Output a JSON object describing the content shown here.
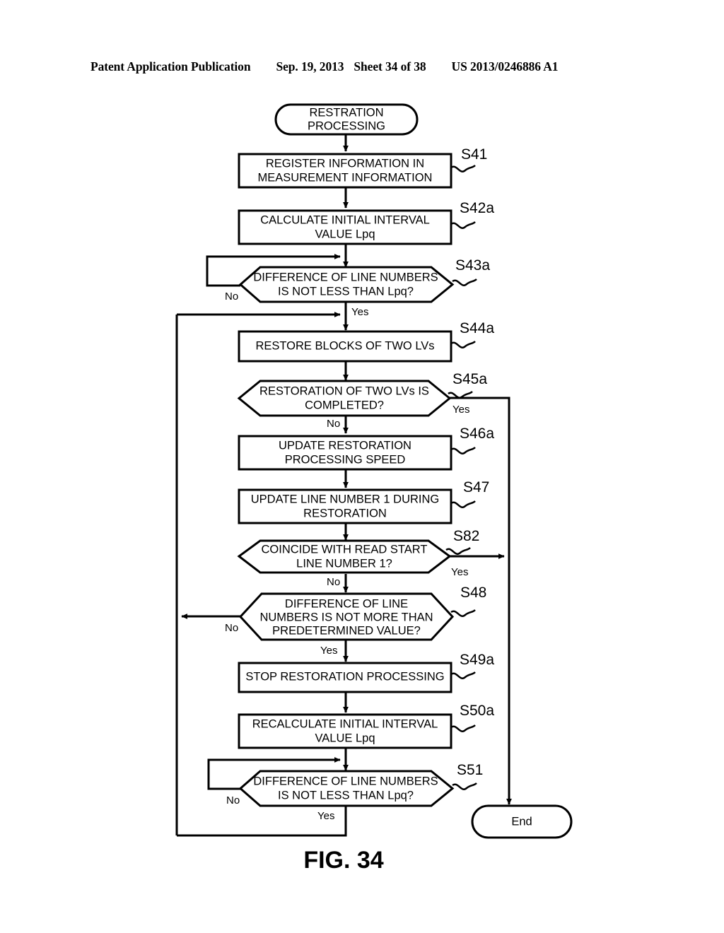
{
  "header": {
    "publication": "Patent Application Publication",
    "date": "Sep. 19, 2013",
    "sheet": "Sheet 34 of 38",
    "patent_number": "US 2013/0246886 A1"
  },
  "figure": {
    "caption": "FIG. 34"
  },
  "flowchart": {
    "start": {
      "line1": "RESTRATION",
      "line2": "PROCESSING"
    },
    "end": {
      "label": "End"
    },
    "nodes": [
      {
        "id": "S41",
        "type": "process",
        "step": "S41",
        "line1": "REGISTER INFORMATION IN",
        "line2": "MEASUREMENT INFORMATION"
      },
      {
        "id": "S42a",
        "type": "process",
        "step": "S42a",
        "line1": "CALCULATE INITIAL INTERVAL",
        "line2": "VALUE Lpq"
      },
      {
        "id": "S43a",
        "type": "decision",
        "step": "S43a",
        "line1": "DIFFERENCE OF LINE NUMBERS",
        "line2": "IS NOT LESS THAN Lpq?",
        "no_label": "No",
        "yes_label": "Yes"
      },
      {
        "id": "S44a",
        "type": "process",
        "step": "S44a",
        "line1": "RESTORE BLOCKS OF TWO LVs",
        "line2": ""
      },
      {
        "id": "S45a",
        "type": "decision",
        "step": "S45a",
        "line1": "RESTORATION OF TWO LVs IS",
        "line2": "COMPLETED?",
        "no_label": "No",
        "yes_label": "Yes"
      },
      {
        "id": "S46a",
        "type": "process",
        "step": "S46a",
        "line1": "UPDATE RESTORATION",
        "line2": "PROCESSING SPEED"
      },
      {
        "id": "S47",
        "type": "process",
        "step": "S47",
        "line1": "UPDATE LINE NUMBER 1 DURING",
        "line2": "RESTORATION"
      },
      {
        "id": "S82",
        "type": "decision",
        "step": "S82",
        "line1": "COINCIDE WITH READ START",
        "line2": "LINE NUMBER 1?",
        "no_label": "No",
        "yes_label": "Yes"
      },
      {
        "id": "S48",
        "type": "decision3",
        "step": "S48",
        "line1": "DIFFERENCE OF LINE",
        "line2": "NUMBERS IS NOT MORE THAN",
        "line3": "PREDETERMINED VALUE?",
        "no_label": "No",
        "yes_label": "Yes"
      },
      {
        "id": "S49a",
        "type": "process",
        "step": "S49a",
        "line1": "STOP RESTORATION PROCESSING",
        "line2": ""
      },
      {
        "id": "S50a",
        "type": "process",
        "step": "S50a",
        "line1": "RECALCULATE INITIAL INTERVAL",
        "line2": "VALUE Lpq"
      },
      {
        "id": "S51",
        "type": "decision",
        "step": "S51",
        "line1": "DIFFERENCE OF LINE NUMBERS",
        "line2": "IS NOT LESS THAN Lpq?",
        "no_label": "No",
        "yes_label": "Yes"
      }
    ]
  },
  "colors": {
    "stroke": "#000000",
    "fill": "#ffffff",
    "text": "#000000"
  }
}
